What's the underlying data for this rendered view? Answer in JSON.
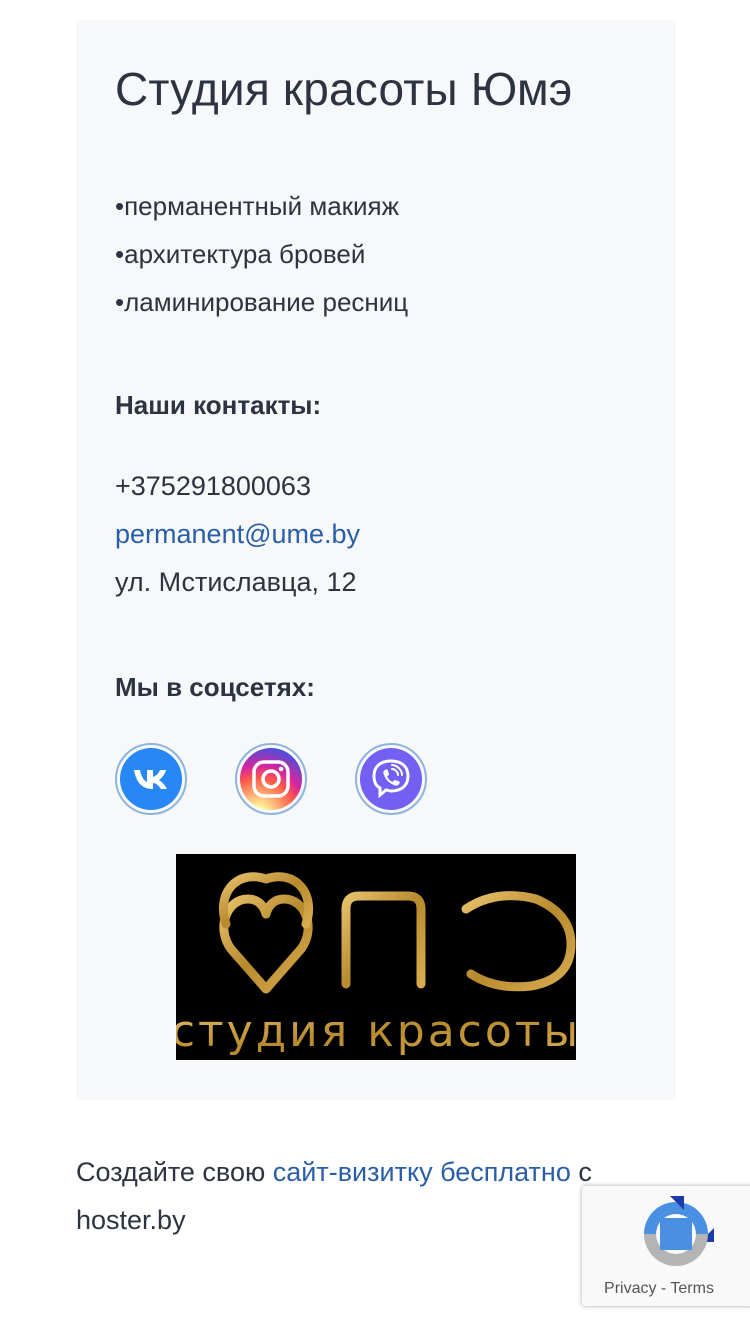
{
  "studio": {
    "title": "Студия красоты Юмэ",
    "services": [
      "•перманентный макияж",
      "•архитектура бровей",
      "•ламинирование ресниц"
    ]
  },
  "contacts": {
    "heading": "Наши контакты:",
    "phone": "+375291800063",
    "email": "permanent@ume.by",
    "address": "ул. Мстиславца, 12"
  },
  "social": {
    "heading": "Мы в соцсетях:",
    "items": [
      {
        "name": "vk",
        "icon": "vk-icon",
        "color": "#2787f5"
      },
      {
        "name": "instagram",
        "icon": "instagram-icon",
        "color": "#e1306c"
      },
      {
        "name": "viber",
        "icon": "viber-icon",
        "color": "#7360f2"
      }
    ]
  },
  "logo": {
    "text_main": "ЮМЭ",
    "text_sub": "студия красоты",
    "color": "#c49a3a"
  },
  "footer": {
    "prefix": "Создайте свою ",
    "link": "сайт-визитку бесплатно",
    "suffix": " с hoster.by"
  },
  "recaptcha": {
    "privacy": "Privacy",
    "separator": " - ",
    "terms": "Terms"
  },
  "colors": {
    "link": "#2a5ea8",
    "card_bg": "#f7f8fa",
    "text": "#2d3340"
  }
}
